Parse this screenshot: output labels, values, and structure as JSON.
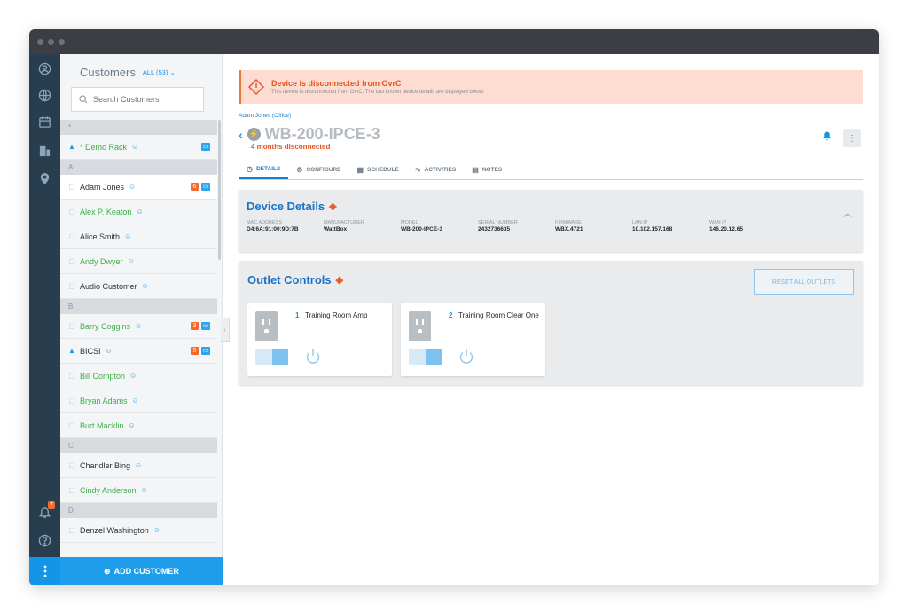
{
  "rail": {
    "icons": [
      "user-circle-icon",
      "globe-icon",
      "calendar-icon",
      "building-icon",
      "location-pin-icon",
      "bell-icon",
      "help-icon",
      "kebab-icon"
    ],
    "notification_count": "7"
  },
  "customers": {
    "title": "Customers",
    "filter_label": "ALL (53)",
    "search_placeholder": "Search Customers",
    "groups": [
      {
        "letter": "*",
        "rows": [
          {
            "name": "* Demo Rack",
            "icon": "bell",
            "badges": [
              "blue"
            ],
            "selected": false,
            "dark": false
          }
        ]
      },
      {
        "letter": "A",
        "rows": [
          {
            "name": "Adam Jones",
            "icon": "device",
            "badges": [
              "6",
              "blue"
            ],
            "selected": true,
            "dark": true
          },
          {
            "name": "Alex P. Keaton",
            "icon": "device",
            "badges": [],
            "selected": false,
            "dark": false
          },
          {
            "name": "Alice Smith",
            "icon": "device",
            "badges": [],
            "selected": false,
            "dark": true
          },
          {
            "name": "Andy Dwyer",
            "icon": "device",
            "badges": [],
            "selected": false,
            "dark": false
          },
          {
            "name": "Audio Customer",
            "icon": "device",
            "badges": [],
            "selected": false,
            "dark": true
          }
        ]
      },
      {
        "letter": "B",
        "rows": [
          {
            "name": "Barry Coggins",
            "icon": "device",
            "badges": [
              "3",
              "blue"
            ],
            "selected": false,
            "dark": false
          },
          {
            "name": "BICSI",
            "icon": "bell",
            "badges": [
              "5",
              "blue"
            ],
            "selected": false,
            "dark": true
          },
          {
            "name": "Bill Compton",
            "icon": "device",
            "badges": [],
            "selected": false,
            "dark": false
          },
          {
            "name": "Bryan Adams",
            "icon": "device",
            "badges": [],
            "selected": false,
            "dark": false
          },
          {
            "name": "Burt Macklin",
            "icon": "device",
            "badges": [],
            "selected": false,
            "dark": false
          }
        ]
      },
      {
        "letter": "C",
        "rows": [
          {
            "name": "Chandler Bing",
            "icon": "device",
            "badges": [],
            "selected": false,
            "dark": true
          },
          {
            "name": "Cindy Anderson",
            "icon": "device",
            "badges": [],
            "selected": false,
            "dark": false
          }
        ]
      },
      {
        "letter": "D",
        "rows": [
          {
            "name": "Denzel Washington",
            "icon": "device",
            "badges": [],
            "selected": false,
            "dark": true
          }
        ]
      }
    ],
    "add_button": "ADD CUSTOMER"
  },
  "alert": {
    "title": "Device is disconnected from OvrC",
    "subtitle": "This device is disconnected from OvrC. The last known device details are displayed below."
  },
  "breadcrumb": "Adam Jones (Office)",
  "device": {
    "name": "WB-200-IPCE-3",
    "status": "4 months disconnected"
  },
  "tabs": [
    {
      "label": "DETAILS",
      "icon": "◷",
      "active": true
    },
    {
      "label": "CONFIGURE",
      "icon": "⚙",
      "active": false
    },
    {
      "label": "SCHEDULE",
      "icon": "▦",
      "active": false
    },
    {
      "label": "ACTIVITIES",
      "icon": "∿",
      "active": false
    },
    {
      "label": "NOTES",
      "icon": "▤",
      "active": false
    }
  ],
  "details": {
    "title": "Device Details",
    "fields": [
      {
        "label": "MAC ADDRESS",
        "value": "D4:6A:91:00:9D:7B"
      },
      {
        "label": "MANUFACTURER",
        "value": "WattBox"
      },
      {
        "label": "MODEL",
        "value": "WB-200-IPCE-3"
      },
      {
        "label": "SERIAL NUMBER",
        "value": "2432736635"
      },
      {
        "label": "FIRMWARE",
        "value": "WBX.4721"
      },
      {
        "label": "LAN IP",
        "value": "10.102.157.168"
      },
      {
        "label": "WAN IP",
        "value": "146.20.12.65"
      }
    ]
  },
  "outlets": {
    "title": "Outlet Controls",
    "reset_label": "RESET ALL OUTLETS",
    "items": [
      {
        "num": "1",
        "name": "Training Room Amp"
      },
      {
        "num": "2",
        "name": "Training Room Clear One"
      }
    ]
  }
}
